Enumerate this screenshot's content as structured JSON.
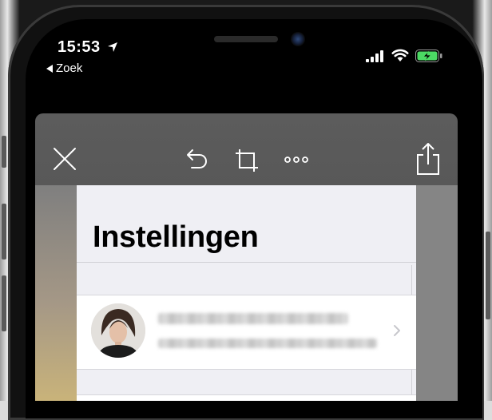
{
  "status_bar": {
    "time": "15:53",
    "back_label": "Zoek",
    "location_icon": "location-arrow-icon",
    "signal_icon": "cellular-signal-icon",
    "wifi_icon": "wifi-icon",
    "battery_icon": "battery-charging-icon",
    "battery_color": "#4cd964"
  },
  "editor_toolbar": {
    "close_icon": "close-icon",
    "undo_icon": "undo-icon",
    "crop_icon": "crop-icon",
    "more_icon": "more-icon",
    "share_icon": "share-icon",
    "icon_color": "#ffffff"
  },
  "screenshot_content": {
    "title": "Instellingen",
    "profile": {
      "avatar_icon": "profile-photo",
      "name_redacted": true,
      "subtitle_redacted": true,
      "chevron_icon": "chevron-right-icon"
    }
  }
}
